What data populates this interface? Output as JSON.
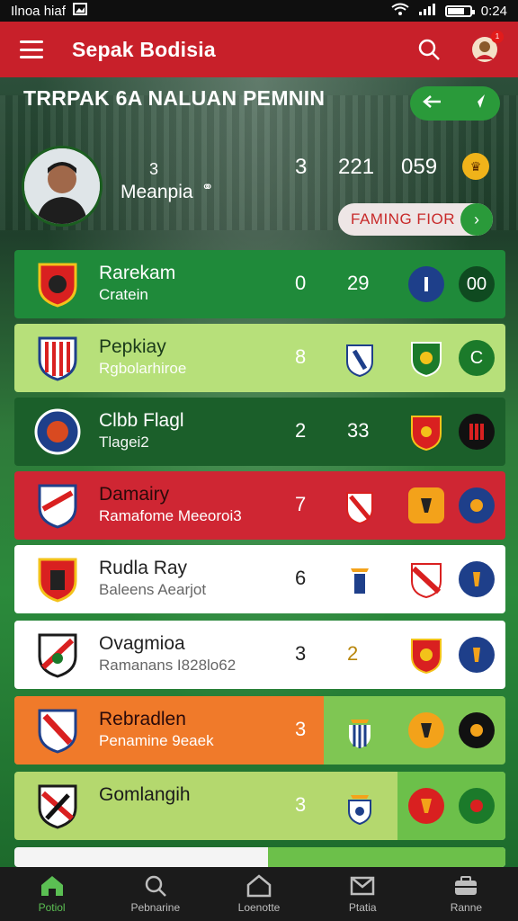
{
  "status_bar": {
    "carrier": "Ilnoa hiaf",
    "time": "0:24"
  },
  "app_bar": {
    "title": "Sepak Bodisia",
    "notification_count": "1"
  },
  "section": {
    "header": "TRRPAK 6A NALUAN PEMNIN"
  },
  "player": {
    "small_label": "3",
    "name": "Meanpia",
    "stats": [
      "3",
      "221",
      "059"
    ],
    "ranking_button": "FAMING FIOR"
  },
  "rows": [
    {
      "name": "Rarekam",
      "sub": "Cratein",
      "val_a": "0",
      "val_b": "29",
      "badge_d": "00"
    },
    {
      "name": "Pepkiay",
      "sub": "Rgbolarhiroe",
      "val_a": "8",
      "badge_d": "C"
    },
    {
      "name": "Clbb Flagl",
      "sub": "Tlagei2",
      "val_a": "2",
      "val_b": "33"
    },
    {
      "name": "Damairy",
      "sub": "Ramafome Meeoroi3",
      "val_a": "7"
    },
    {
      "name": "Rudla Ray",
      "sub": "Baleens Aearjot",
      "val_a": "6"
    },
    {
      "name": "Ovagmioa",
      "sub": "Ramanans I828lo62",
      "val_a": "3",
      "val_b": "2"
    },
    {
      "name": "Rebradlen",
      "sub": "Penamine 9eaek",
      "val_a": "3"
    },
    {
      "name": "Gomlangih",
      "sub": "",
      "val_a": "3"
    }
  ],
  "bottom_nav": [
    {
      "label": "Potiol",
      "active": true
    },
    {
      "label": "Pebnarine",
      "active": false
    },
    {
      "label": "Loenotte",
      "active": false
    },
    {
      "label": "Ptatia",
      "active": false
    },
    {
      "label": "Ranne",
      "active": false
    }
  ],
  "colors": {
    "primary_red": "#c8202a",
    "primary_green": "#2a9a3a",
    "nav_bg": "#1b1b1b"
  }
}
